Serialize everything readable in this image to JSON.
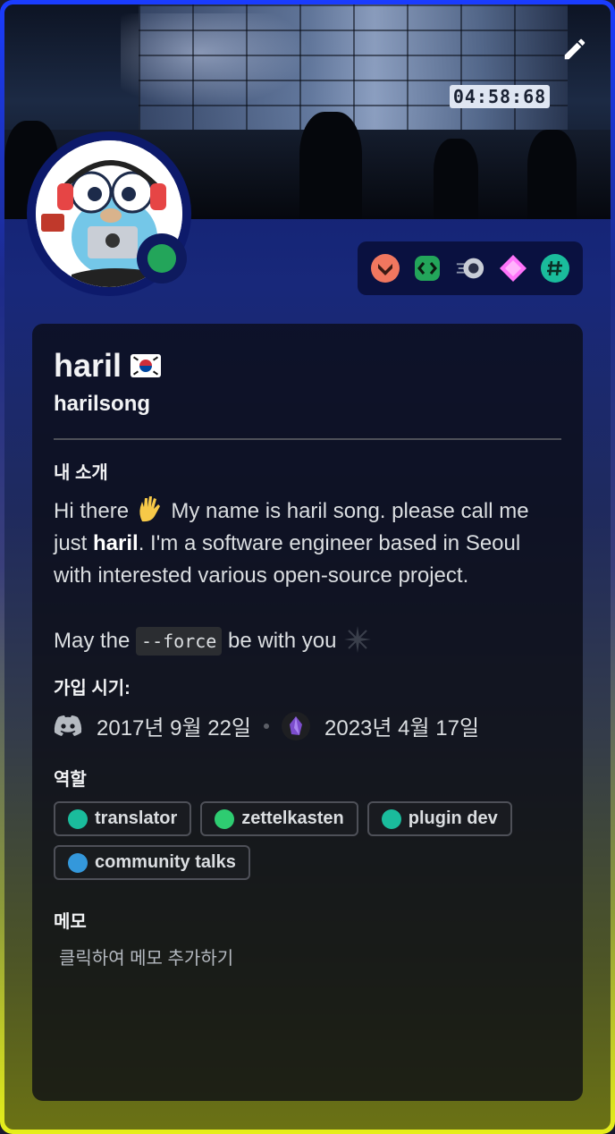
{
  "banner": {
    "clock_text": "04:58:68"
  },
  "profile": {
    "display_name": "haril",
    "username": "harilsong",
    "status_color": "#23a55a"
  },
  "badges": [
    {
      "icon": "hypesquad-badge",
      "color": "#f0775f"
    },
    {
      "icon": "active-developer-badge",
      "color": "#23a55a"
    },
    {
      "icon": "early-supporter-badge",
      "color": "#c9cdd6"
    },
    {
      "icon": "nitro-gem-badge",
      "color": "#ff73fa"
    },
    {
      "icon": "server-tag-badge",
      "color": "#1abc9c"
    }
  ],
  "about": {
    "title": "내 소개",
    "line1_pre": "Hi there ",
    "line1_post": " My name is haril song. please call me just ",
    "bold_name": "haril",
    "line1_end": ". I'm a software engineer based in Seoul with interested various open-source project.",
    "line2_pre": "May the ",
    "code": "--force",
    "line2_post": " be with you"
  },
  "member_since": {
    "title": "가입 시기:",
    "discord_date": "2017년 9월 22일",
    "server_date": "2023년 4월 17일"
  },
  "roles": {
    "title": "역할",
    "items": [
      {
        "label": "translator",
        "color": "#1abc9c"
      },
      {
        "label": "zettelkasten",
        "color": "#2ecc71"
      },
      {
        "label": "plugin dev",
        "color": "#1abc9c"
      },
      {
        "label": "community talks",
        "color": "#3498db"
      }
    ]
  },
  "note": {
    "title": "메모",
    "placeholder": "클릭하여 메모 추가하기"
  }
}
